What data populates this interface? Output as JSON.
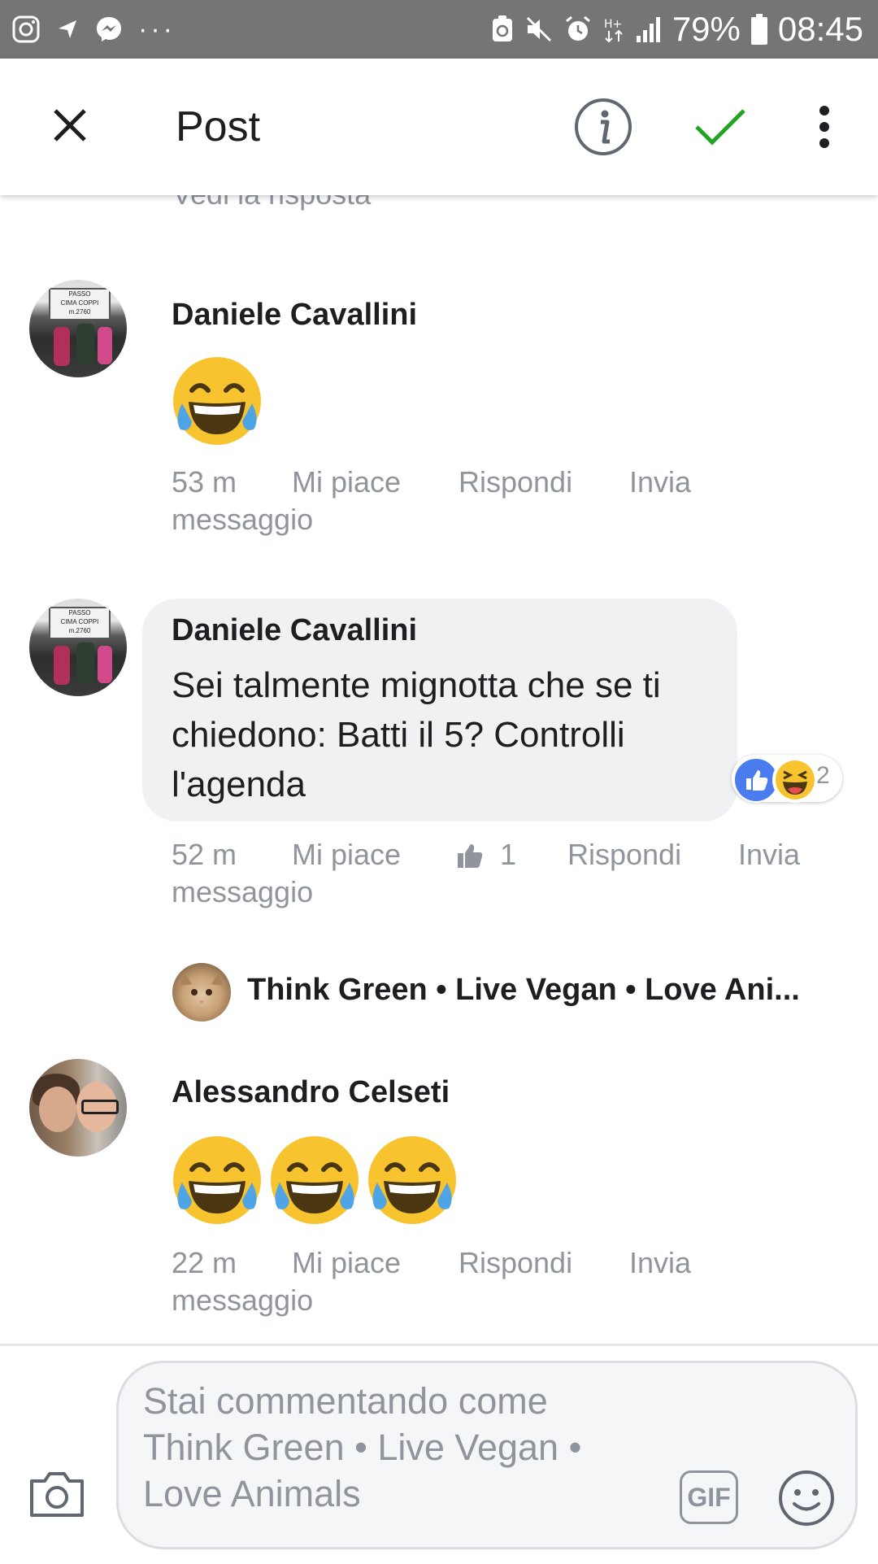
{
  "status_bar": {
    "icons_left": [
      "instagram-icon",
      "navigation-icon",
      "messenger-icon"
    ],
    "more": "···",
    "icons_right": [
      "recycle-notification-icon",
      "mute-icon",
      "alarm-icon",
      "network-hplus-icon",
      "signal-icon",
      "battery-icon"
    ],
    "battery": "79%",
    "time": "08:45"
  },
  "app_bar": {
    "title": "Post",
    "icons": [
      "close-icon",
      "info-icon",
      "checkmark-icon",
      "more-vertical-icon"
    ],
    "check_color": "#21a421"
  },
  "see_reply": "Vedi la risposta",
  "comments": [
    {
      "author": "Daniele Cavallini",
      "content": [
        "face-with-tears-of-joy-emoji"
      ],
      "time": "53 m",
      "actions": {
        "like": "Mi piace",
        "reply": "Rispondi",
        "send": "Invia",
        "send_2": "messaggio"
      }
    },
    {
      "author": "Daniele Cavallini",
      "text": "Sei talmente mignotta che se ti chiedono: Batti il 5? Controlli l'agenda",
      "reactions": {
        "types": [
          "like-reaction-icon",
          "haha-reaction-icon"
        ],
        "count": "2"
      },
      "time": "52 m",
      "actions": {
        "like": "Mi piace",
        "like_count": "1",
        "reply": "Rispondi",
        "send": "Invia",
        "send_2": "messaggio"
      }
    },
    {
      "shared_as": "Think Green • Live Vegan • Love Ani..."
    },
    {
      "author": "Alessandro Celseti",
      "content": [
        "face-with-tears-of-joy-emoji",
        "face-with-tears-of-joy-emoji",
        "face-with-tears-of-joy-emoji"
      ],
      "time": "22 m",
      "actions": {
        "like": "Mi piace",
        "reply": "Rispondi",
        "send": "Invia",
        "send_2": "messaggio"
      }
    }
  ],
  "composer": {
    "placeholder": "Stai commentando come Think Green • Live Vegan • Love Animals",
    "gif": "GIF",
    "icons": [
      "camera-icon",
      "gif-icon",
      "smiley-icon"
    ]
  },
  "colors": {
    "status_bar": "#757575",
    "accent_blue": "#4a7cf0",
    "meta_text": "#90949c",
    "bubble_bg": "#f0f1f3"
  }
}
